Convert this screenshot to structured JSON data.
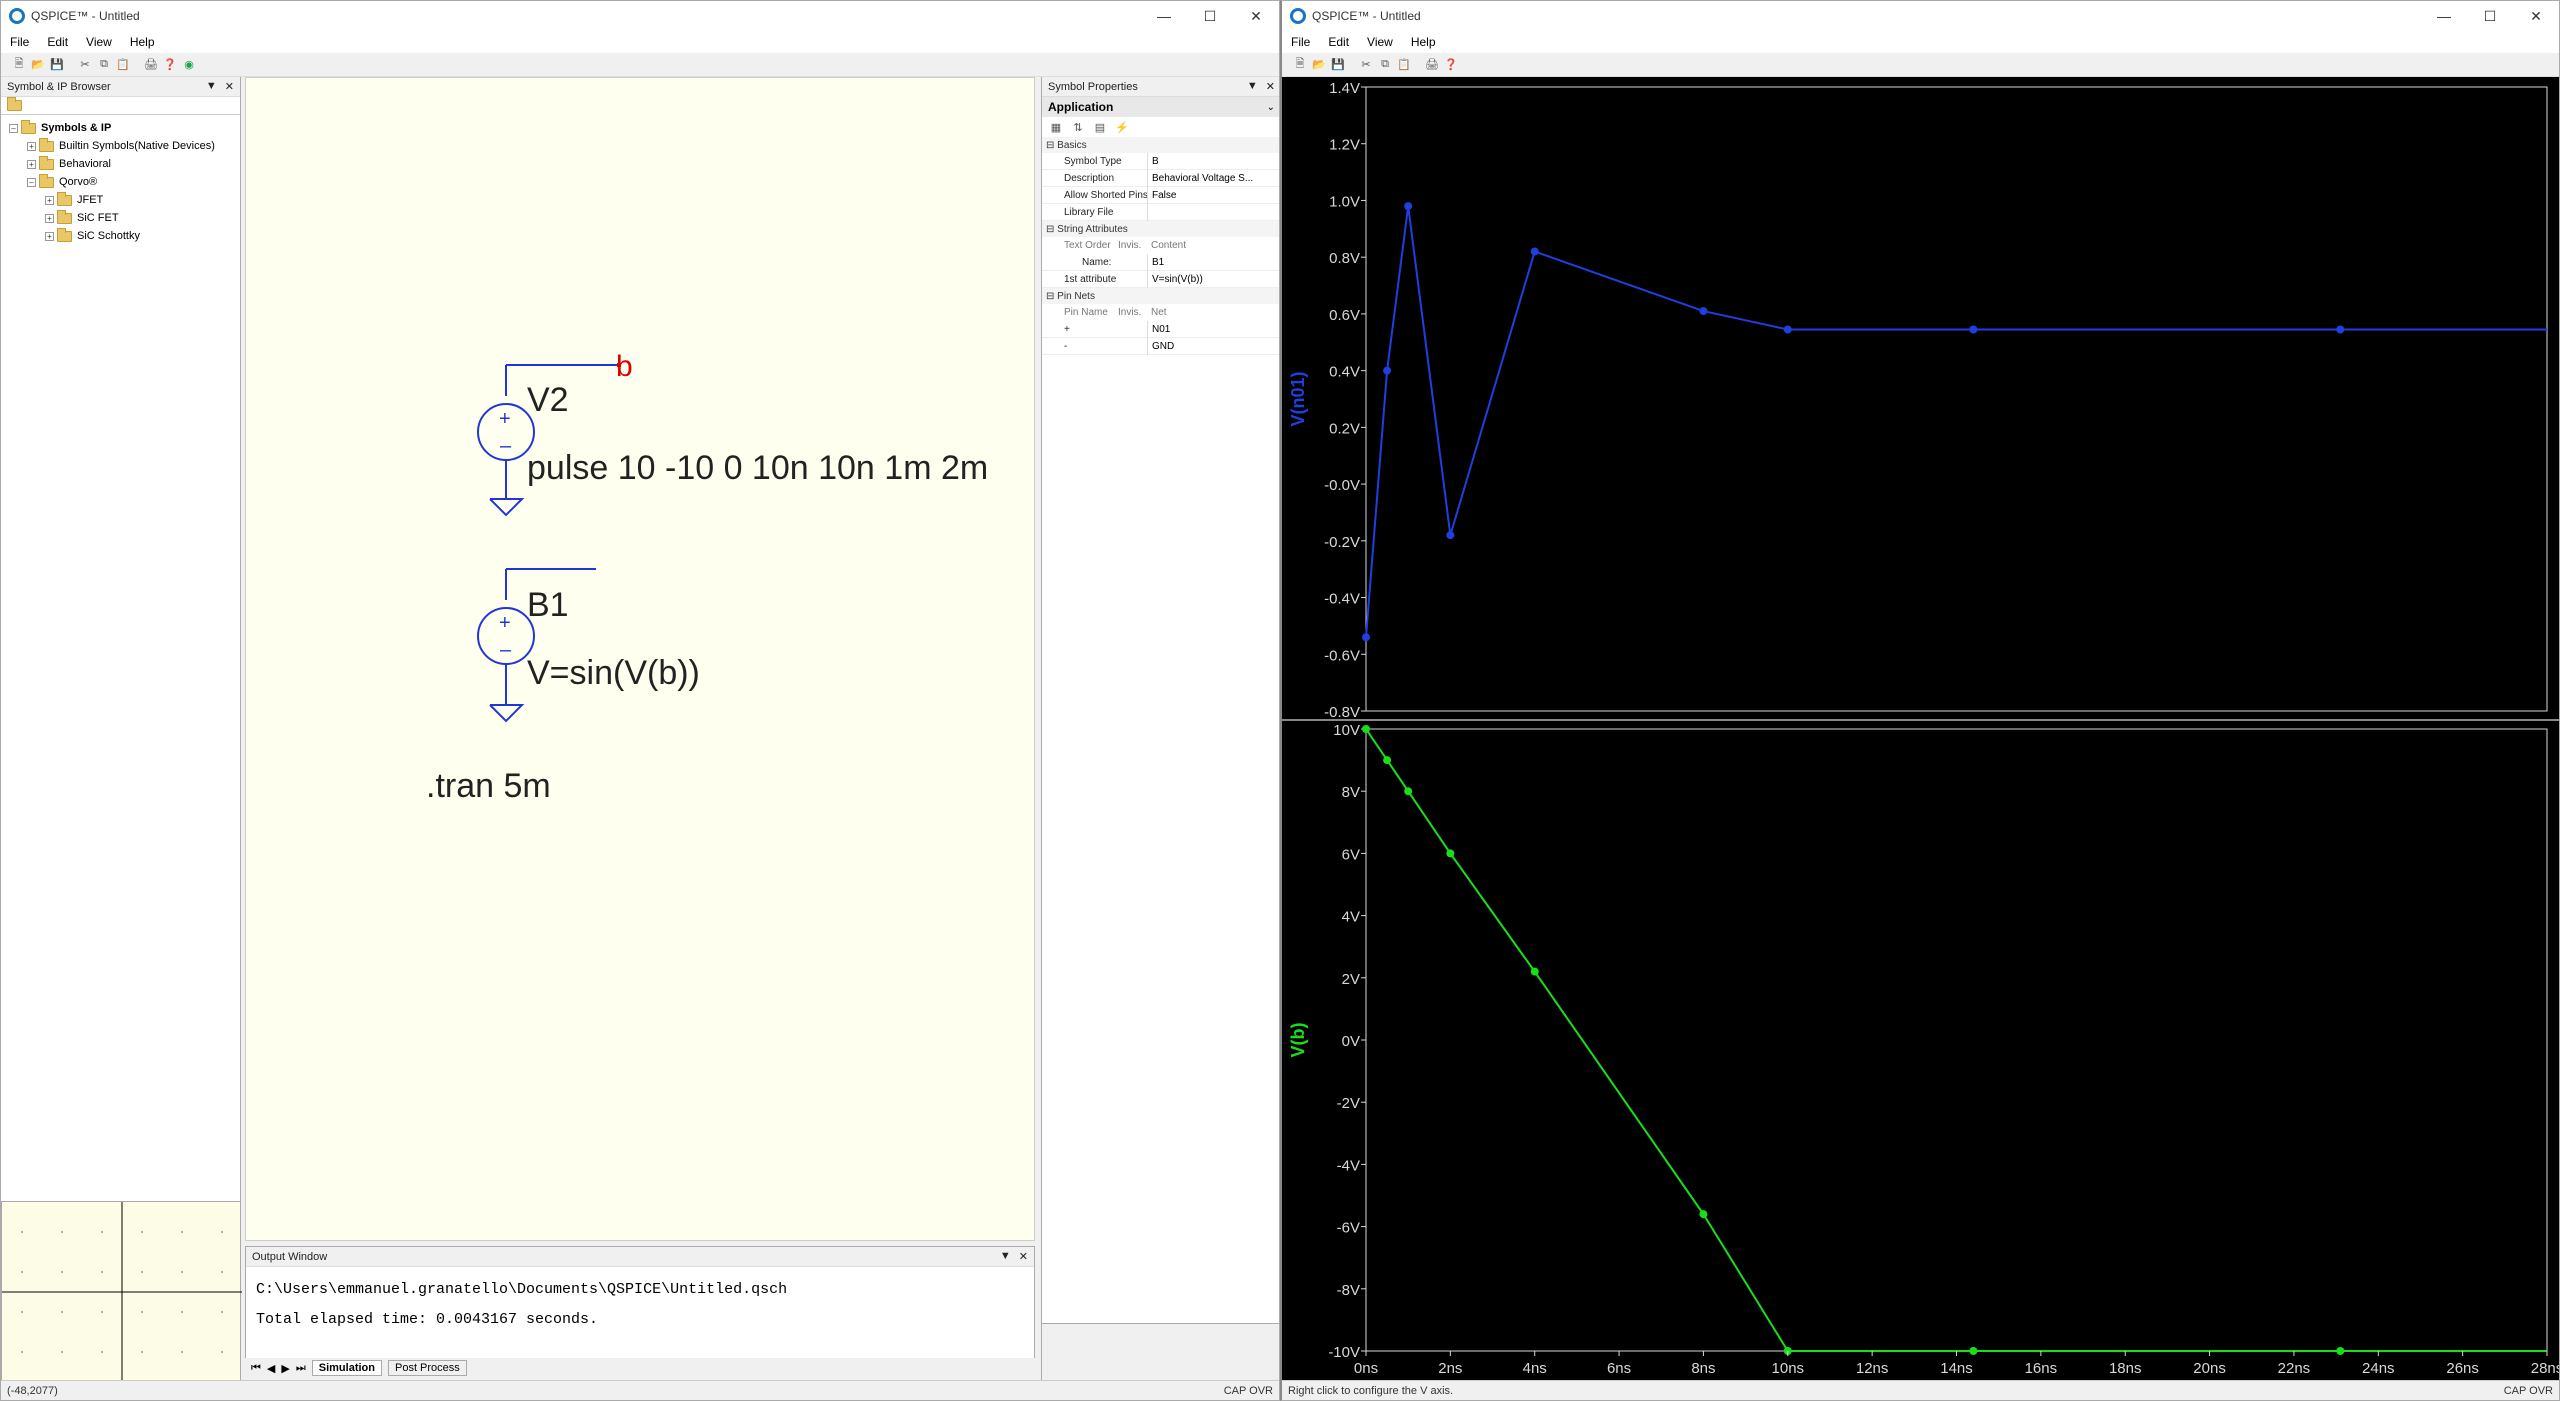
{
  "left_window": {
    "title": "QSPICE™ - Untitled",
    "menu": [
      "File",
      "Edit",
      "View",
      "Help"
    ],
    "browser": {
      "title": "Symbol & IP Browser",
      "tree": [
        {
          "label": "Symbols & IP",
          "level": 0,
          "bold": true
        },
        {
          "label": "Builtin Symbols(Native Devices)",
          "level": 1
        },
        {
          "label": "Behavioral",
          "level": 1
        },
        {
          "label": "Qorvo®",
          "level": 1
        },
        {
          "label": "JFET",
          "level": 2
        },
        {
          "label": "SiC FET",
          "level": 2
        },
        {
          "label": "SiC Schottky",
          "level": 2
        }
      ]
    },
    "schematic": {
      "v2_name": "V2",
      "v2_value": "pulse 10 -10 0 10n 10n 1m 2m",
      "net_label": "b",
      "b1_name": "B1",
      "b1_value": "V=sin(V(b))",
      "directive": ".tran 5m"
    },
    "properties": {
      "title": "Symbol Properties",
      "section": "Application",
      "basics_label": "Basics",
      "basics": [
        {
          "k": "Symbol Type",
          "v": "B"
        },
        {
          "k": "Description",
          "v": "Behavioral Voltage S..."
        },
        {
          "k": "Allow Shorted Pins",
          "v": "False"
        },
        {
          "k": "Library File",
          "v": ""
        }
      ],
      "string_attrs_label": "String Attributes",
      "string_header": {
        "a": "Text Order",
        "b": "Invis.",
        "c": "Content"
      },
      "string_attrs": [
        {
          "k": "Name:",
          "v": "B1"
        },
        {
          "k": "1st attribute",
          "v": "V=sin(V(b))"
        }
      ],
      "pin_nets_label": "Pin Nets",
      "pin_header": {
        "a": "Pin Name",
        "b": "Invis.",
        "c": "Net"
      },
      "pins": [
        {
          "k": "+",
          "v": "N01"
        },
        {
          "k": "-",
          "v": "GND"
        }
      ]
    },
    "output": {
      "title": "Output Window",
      "line1": "C:\\Users\\emmanuel.granatello\\Documents\\QSPICE\\Untitled.qsch",
      "line2": "Total elapsed time: 0.0043167 seconds.",
      "tabs": [
        "Simulation",
        "Post Process"
      ]
    },
    "status": {
      "coords": "(-48,2077)",
      "indicators": "CAP OVR"
    }
  },
  "right_window": {
    "title": "QSPICE™ - Untitled",
    "menu": [
      "File",
      "Edit",
      "View",
      "Help"
    ],
    "status": {
      "hint": "Right click to configure the V axis.",
      "indicators": "CAP OVR"
    }
  },
  "chart_data": [
    {
      "type": "line",
      "ylabel": "V(n01)",
      "color": "#1f3fe0",
      "ylim": [
        -0.8,
        1.4
      ],
      "yticks": [
        "1.4V",
        "1.2V",
        "1.0V",
        "0.8V",
        "0.6V",
        "0.4V",
        "0.2V",
        "-0.0V",
        "-0.2V",
        "-0.4V",
        "-0.6V",
        "-0.8V"
      ],
      "x": [
        0,
        0.5,
        1,
        2,
        4,
        8,
        10,
        14.4,
        23.1,
        28
      ],
      "values": [
        -0.54,
        0.4,
        0.98,
        -0.18,
        0.82,
        0.61,
        0.545,
        0.545,
        0.545,
        0.545
      ]
    },
    {
      "type": "line",
      "ylabel": "V(b)",
      "color": "#18e018",
      "ylim": [
        -10,
        10
      ],
      "yticks": [
        "10V",
        "8V",
        "6V",
        "4V",
        "2V",
        "0V",
        "-2V",
        "-4V",
        "-6V",
        "-8V",
        "-10V"
      ],
      "x": [
        0,
        0.5,
        1,
        2,
        4,
        8,
        10,
        14.4,
        23.1,
        28
      ],
      "values": [
        10,
        9,
        8,
        6,
        2.2,
        -5.6,
        -10,
        -10,
        -10,
        -10
      ],
      "xlim": [
        0,
        28
      ],
      "xticks": [
        "0ns",
        "2ns",
        "4ns",
        "6ns",
        "8ns",
        "10ns",
        "12ns",
        "14ns",
        "16ns",
        "18ns",
        "20ns",
        "22ns",
        "24ns",
        "26ns",
        "28ns"
      ]
    }
  ]
}
